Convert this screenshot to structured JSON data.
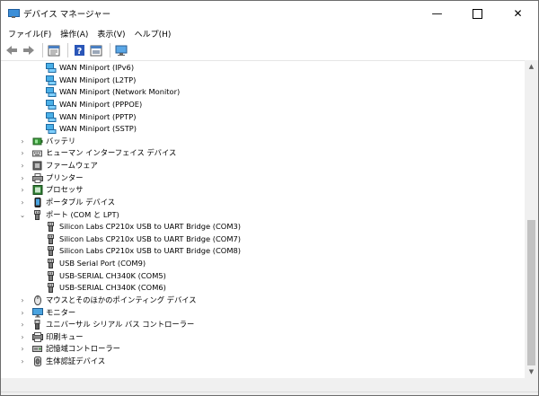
{
  "window": {
    "title": "デバイス マネージャー"
  },
  "menubar": {
    "items": [
      "ファイル(F)",
      "操作(A)",
      "表示(V)",
      "ヘルプ(H)"
    ]
  },
  "toolbar": {
    "icons": [
      "back-icon",
      "forward-icon",
      "properties-icon",
      "help-icon",
      "update-driver-icon",
      "monitor-icon"
    ]
  },
  "tree": {
    "rows": [
      {
        "label": "WAN Miniport (IPv6)",
        "icon": "network-adapter-icon",
        "level": 2,
        "expander": ""
      },
      {
        "label": "WAN Miniport (L2TP)",
        "icon": "network-adapter-icon",
        "level": 2,
        "expander": ""
      },
      {
        "label": "WAN Miniport (Network Monitor)",
        "icon": "network-adapter-icon",
        "level": 2,
        "expander": ""
      },
      {
        "label": "WAN Miniport (PPPOE)",
        "icon": "network-adapter-icon",
        "level": 2,
        "expander": ""
      },
      {
        "label": "WAN Miniport (PPTP)",
        "icon": "network-adapter-icon",
        "level": 2,
        "expander": ""
      },
      {
        "label": "WAN Miniport (SSTP)",
        "icon": "network-adapter-icon",
        "level": 2,
        "expander": ""
      },
      {
        "label": "バッテリ",
        "icon": "battery-icon",
        "level": 1,
        "expander": "›"
      },
      {
        "label": "ヒューマン インターフェイス デバイス",
        "icon": "hid-icon",
        "level": 1,
        "expander": "›"
      },
      {
        "label": "ファームウェア",
        "icon": "firmware-icon",
        "level": 1,
        "expander": "›"
      },
      {
        "label": "プリンター",
        "icon": "printer-icon",
        "level": 1,
        "expander": "›"
      },
      {
        "label": "プロセッサ",
        "icon": "processor-icon",
        "level": 1,
        "expander": "›"
      },
      {
        "label": "ポータブル デバイス",
        "icon": "portable-device-icon",
        "level": 1,
        "expander": "›"
      },
      {
        "label": "ポート (COM と LPT)",
        "icon": "port-icon",
        "level": 1,
        "expander": "⌄"
      },
      {
        "label": "Silicon Labs CP210x USB to UART Bridge (COM3)",
        "icon": "port-icon",
        "level": 2,
        "expander": ""
      },
      {
        "label": "Silicon Labs CP210x USB to UART Bridge (COM7)",
        "icon": "port-icon",
        "level": 2,
        "expander": ""
      },
      {
        "label": "Silicon Labs CP210x USB to UART Bridge (COM8)",
        "icon": "port-icon",
        "level": 2,
        "expander": ""
      },
      {
        "label": "USB Serial Port (COM9)",
        "icon": "port-icon",
        "level": 2,
        "expander": ""
      },
      {
        "label": "USB-SERIAL CH340K (COM5)",
        "icon": "port-icon",
        "level": 2,
        "expander": ""
      },
      {
        "label": "USB-SERIAL CH340K (COM6)",
        "icon": "port-icon",
        "level": 2,
        "expander": ""
      },
      {
        "label": "マウスとそのほかのポインティング デバイス",
        "icon": "mouse-icon",
        "level": 1,
        "expander": "›"
      },
      {
        "label": "モニター",
        "icon": "monitor-icon",
        "level": 1,
        "expander": "›"
      },
      {
        "label": "ユニバーサル シリアル バス コントローラー",
        "icon": "usb-controller-icon",
        "level": 1,
        "expander": "›"
      },
      {
        "label": "印刷キュー",
        "icon": "print-queue-icon",
        "level": 1,
        "expander": "›"
      },
      {
        "label": "記憶域コントローラー",
        "icon": "storage-controller-icon",
        "level": 1,
        "expander": "›"
      },
      {
        "label": "生体認証デバイス",
        "icon": "biometric-icon",
        "level": 1,
        "expander": "›"
      }
    ]
  }
}
